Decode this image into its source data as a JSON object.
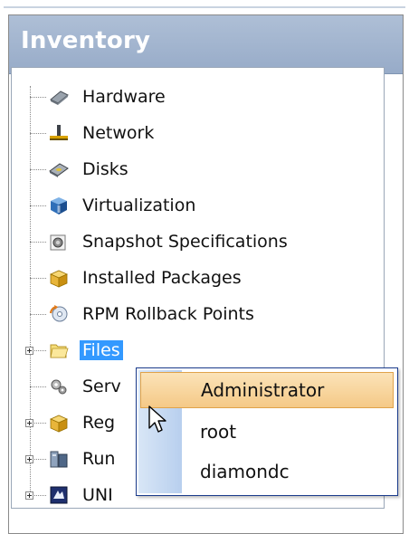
{
  "panel": {
    "title": "Inventory"
  },
  "tree": {
    "items": [
      {
        "label": "Hardware",
        "icon": "hardware-icon"
      },
      {
        "label": "Network",
        "icon": "network-icon"
      },
      {
        "label": "Disks",
        "icon": "disk-icon"
      },
      {
        "label": "Virtualization",
        "icon": "virtualization-icon"
      },
      {
        "label": "Snapshot Specifications",
        "icon": "snapshot-icon"
      },
      {
        "label": "Installed Packages",
        "icon": "package-icon"
      },
      {
        "label": "RPM Rollback Points",
        "icon": "rollback-icon"
      },
      {
        "label": "Files",
        "icon": "folder-icon",
        "selected": true
      },
      {
        "label": "Serv",
        "icon": "services-icon"
      },
      {
        "label": "Reg",
        "icon": "registry-icon"
      },
      {
        "label": "Run",
        "icon": "running-icon"
      },
      {
        "label": "UNI",
        "icon": "unix-icon"
      }
    ]
  },
  "context_menu": {
    "items": [
      {
        "label": "Administrator",
        "highlighted": true
      },
      {
        "label": "root"
      },
      {
        "label": "diamondc"
      }
    ]
  },
  "colors": {
    "header": "#97abc8",
    "selection": "#3399ff",
    "menu_highlight": "#f5c987",
    "menu_border": "#1a3b8c"
  }
}
